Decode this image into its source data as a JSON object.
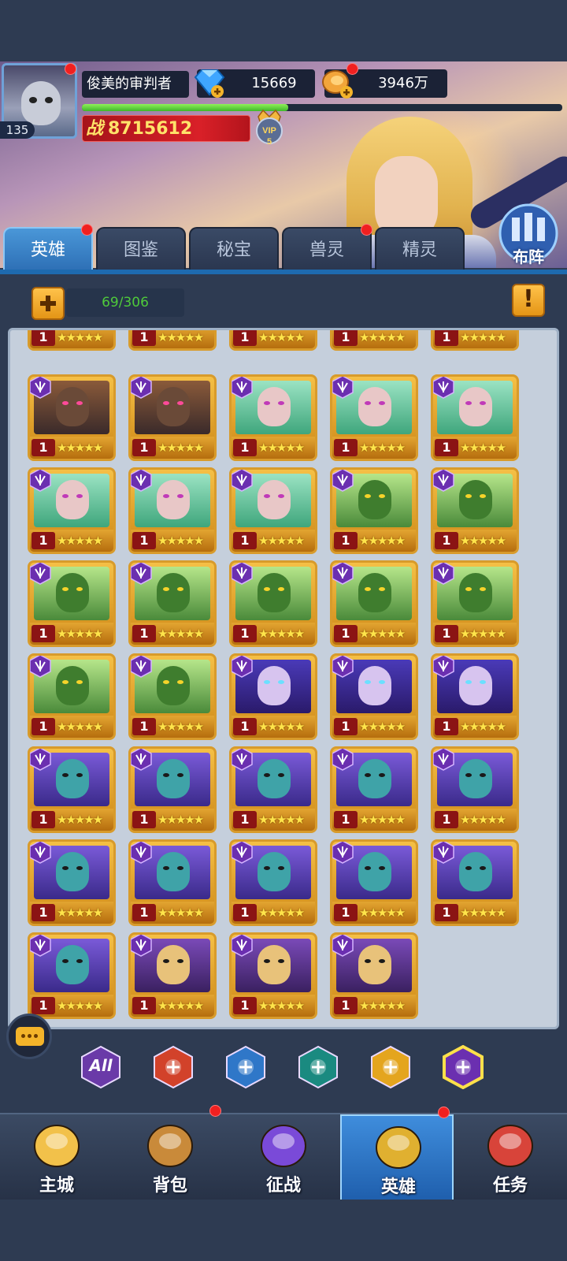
{
  "player": {
    "name": "俊美的审判者",
    "level": "135",
    "gems": "15669",
    "gold": "3946万",
    "power_label": "战",
    "power": "8715612",
    "vip_label": "VIP",
    "vip_level": "5",
    "exp_fraction": 0.43
  },
  "tabs": [
    {
      "label": "英雄",
      "active": true,
      "dot": true
    },
    {
      "label": "图鉴",
      "active": false,
      "dot": false
    },
    {
      "label": "秘宝",
      "active": false,
      "dot": false
    },
    {
      "label": "兽灵",
      "active": false,
      "dot": true
    },
    {
      "label": "精灵",
      "active": false,
      "dot": false
    }
  ],
  "formation_label": "布阵",
  "hero_count": "69/306",
  "info_symbol": "!",
  "grid": {
    "partial_top_row": [
      "1",
      "1",
      "1",
      "1",
      "1"
    ],
    "rows": [
      [
        "warrior",
        "warrior",
        "dryad",
        "dryad",
        "dryad"
      ],
      [
        "dryad",
        "dryad",
        "dryad",
        "lizard",
        "lizard"
      ],
      [
        "lizard",
        "lizard",
        "lizard",
        "lizard",
        "lizard"
      ],
      [
        "lizard",
        "lizard",
        "sorceress",
        "sorceress",
        "sorceress"
      ],
      [
        "shaman",
        "shaman",
        "shaman",
        "shaman",
        "shaman"
      ],
      [
        "shaman",
        "shaman",
        "shaman",
        "shaman",
        "shaman"
      ],
      [
        "shaman",
        "masked",
        "masked",
        "masked"
      ]
    ],
    "level": "1",
    "stars": "★★★★★",
    "faction_icon": "dark-faction-icon"
  },
  "filters": [
    {
      "label": "All",
      "icon": "all-factions-icon",
      "color": "#6a3aa8"
    },
    {
      "label": "",
      "icon": "fire-faction-icon",
      "color": "#d2422a"
    },
    {
      "label": "",
      "icon": "water-faction-icon",
      "color": "#2f77c8"
    },
    {
      "label": "",
      "icon": "undead-faction-icon",
      "color": "#1a8a80"
    },
    {
      "label": "",
      "icon": "light-faction-icon",
      "color": "#e4a51e"
    },
    {
      "label": "",
      "icon": "dark-faction-icon",
      "color": "#6b2fb0"
    }
  ],
  "nav": [
    {
      "label": "主城",
      "icon": "castle-icon",
      "active": false,
      "dot": false
    },
    {
      "label": "背包",
      "icon": "chest-icon",
      "active": false,
      "dot": true
    },
    {
      "label": "征战",
      "icon": "dragon-portal-icon",
      "active": false,
      "dot": false
    },
    {
      "label": "英雄",
      "icon": "helmet-icon",
      "active": true,
      "dot": true
    },
    {
      "label": "任务",
      "icon": "scroll-icon",
      "active": false,
      "dot": false
    }
  ]
}
